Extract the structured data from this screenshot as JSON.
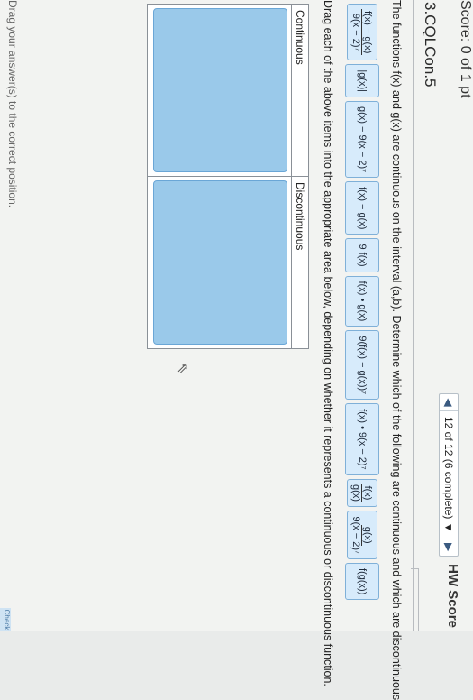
{
  "header": {
    "score_text": "Score: 0 of 1 pt",
    "progress_label": "12 of 12 (6 complete)",
    "hw_score_label": "HW Score"
  },
  "problem": {
    "id": "3.CQLCon.5",
    "question": "The functions f(x) and g(x) are continuous on the interval (a,b). Determine which of the following are continuous and which are discontinuous",
    "tiles": [
      {
        "kind": "frac",
        "num": "f(x) − g(x)",
        "den": "9(x − 2)⁷"
      },
      {
        "kind": "text",
        "text": "|g(x)|"
      },
      {
        "kind": "text",
        "text": "g(x) − 9(x − 2)⁷"
      },
      {
        "kind": "text",
        "text": "f(x) − g(x)"
      },
      {
        "kind": "text",
        "text": "9 f(x)"
      },
      {
        "kind": "text",
        "text": "f(x) • g(x)"
      },
      {
        "kind": "text",
        "text": "9(f(x) − g(x))⁷"
      },
      {
        "kind": "text",
        "text": "f(x) • 9(x − 2)⁷"
      },
      {
        "kind": "frac",
        "num": "f(x)",
        "den": "g(x)"
      },
      {
        "kind": "frac",
        "num": "g(x)",
        "den": "9(x − 2)⁷"
      },
      {
        "kind": "text",
        "text": "f(g(x))"
      }
    ],
    "instruction": "Drag each of the above items into the appropriate area below, depending on whether it represents a continuous or discontinuous function.",
    "zones": [
      {
        "label": "Continuous"
      },
      {
        "label": "Discontinuous"
      }
    ],
    "hint": "Drag your answer(s) to the correct position."
  },
  "colors": {
    "tile_bg": "#d7ebfb",
    "drop_bg": "#9ac9ea",
    "accent": "#3a5a80"
  },
  "icons": {
    "prev": "triangle-left-icon",
    "dropdown": "triangle-down-icon",
    "next": "triangle-right-icon",
    "cursor": "mouse-cursor-icon"
  },
  "footer": {
    "check_label": "Check"
  }
}
